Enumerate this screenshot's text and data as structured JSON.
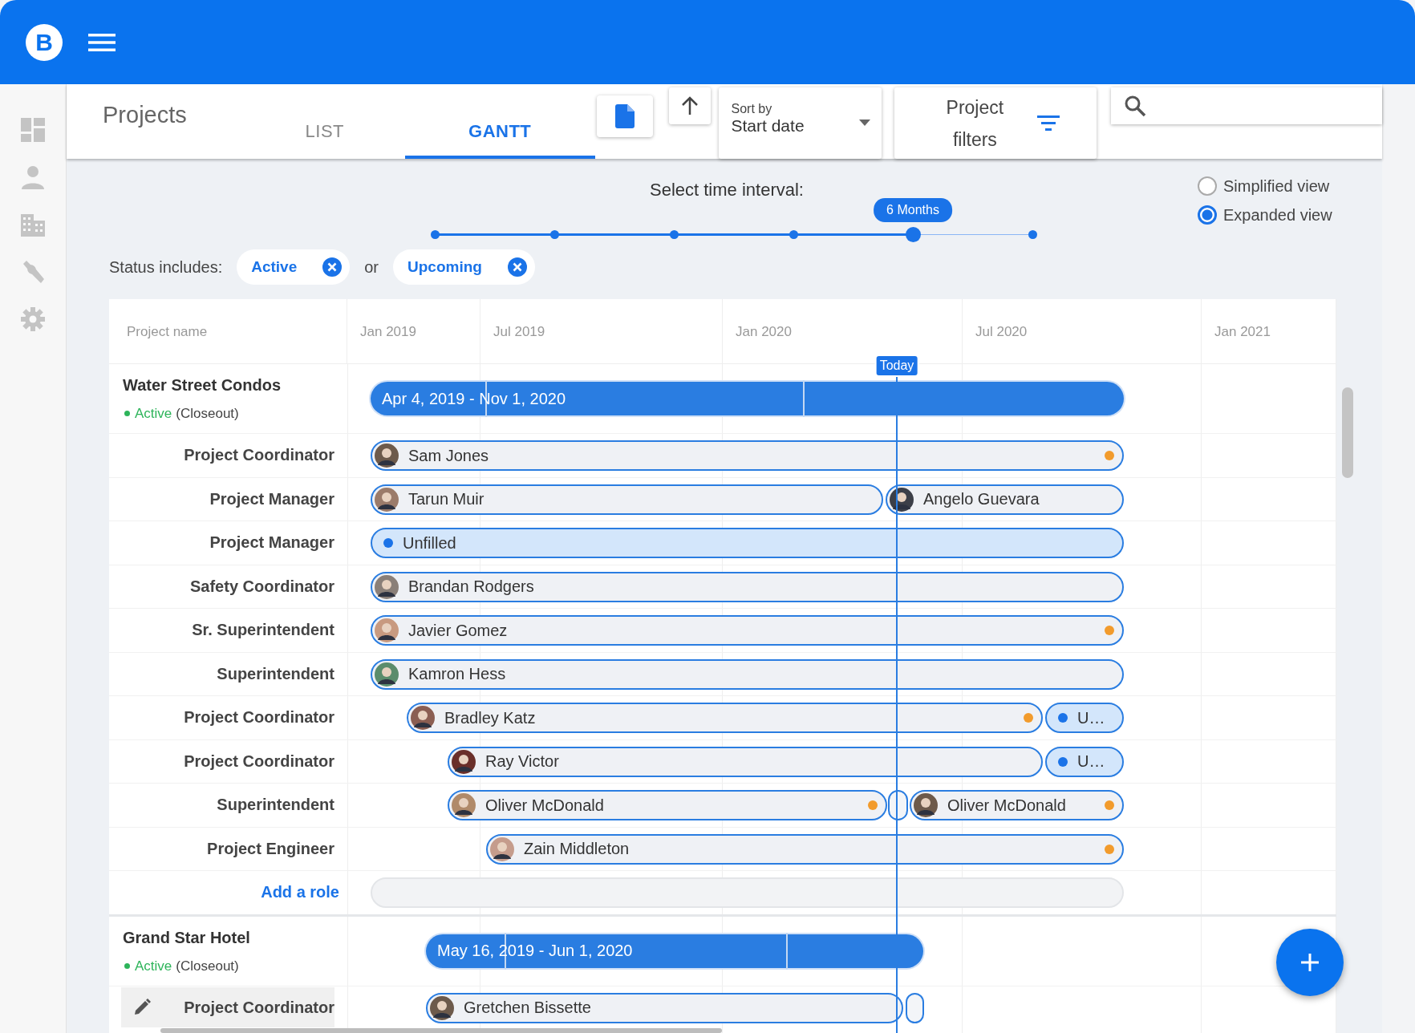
{
  "app_bar": {
    "logo": "B"
  },
  "header": {
    "title": "Projects",
    "tabs": [
      {
        "label": "LIST",
        "selected": false
      },
      {
        "label": "GANTT",
        "selected": true
      }
    ],
    "sort": {
      "label": "Sort by",
      "value": "Start date"
    },
    "filters_button": "Project filters"
  },
  "time_interval": {
    "label": "Select time interval:",
    "value_label": "6 Months",
    "level": 0.8
  },
  "views": [
    {
      "label": "Simplified view",
      "selected": false
    },
    {
      "label": "Expanded view",
      "selected": true
    }
  ],
  "status_filter": {
    "label": "Status includes:",
    "joiner": "or",
    "chips": [
      {
        "label": "Active"
      },
      {
        "label": "Upcoming"
      }
    ]
  },
  "gantt": {
    "name_column": "Project name",
    "months": [
      "Jan 2019",
      "Jul 2019",
      "Jan 2020",
      "Jul 2020",
      "Jan 2021"
    ],
    "today": "Today",
    "projects": [
      {
        "name": "Water Street Condos",
        "status": "Active",
        "phase": "(Closeout)",
        "dates": "Apr 4, 2019 - Nov 1, 2020",
        "add_role": "Add a role",
        "roles": [
          {
            "role": "Project Coordinator",
            "hovered": false,
            "assignments": [
              {
                "kind": "person",
                "name": "Sam Jones",
                "flagged": true
              }
            ]
          },
          {
            "role": "Project Manager",
            "hovered": false,
            "assignments": [
              {
                "kind": "person",
                "name": "Tarun Muir",
                "flagged": false
              },
              {
                "kind": "person",
                "name": "Angelo Guevara",
                "flagged": false
              }
            ]
          },
          {
            "role": "Project Manager",
            "hovered": false,
            "assignments": [
              {
                "kind": "unfilled",
                "name": "Unfilled",
                "flagged": false
              }
            ]
          },
          {
            "role": "Safety Coordinator",
            "hovered": false,
            "assignments": [
              {
                "kind": "person",
                "name": "Brandan Rodgers",
                "flagged": false
              }
            ]
          },
          {
            "role": "Sr. Superintendent",
            "hovered": false,
            "assignments": [
              {
                "kind": "person",
                "name": "Javier Gomez",
                "flagged": true
              }
            ]
          },
          {
            "role": "Superintendent",
            "hovered": false,
            "assignments": [
              {
                "kind": "person",
                "name": "Kamron Hess",
                "flagged": false
              }
            ]
          },
          {
            "role": "Project Coordinator",
            "hovered": false,
            "assignments": [
              {
                "kind": "person",
                "name": "Bradley Katz",
                "flagged": true
              },
              {
                "kind": "unfilled",
                "name": "U…",
                "flagged": false
              }
            ]
          },
          {
            "role": "Project Coordinator",
            "hovered": false,
            "assignments": [
              {
                "kind": "person",
                "name": "Ray Victor",
                "flagged": false
              },
              {
                "kind": "unfilled",
                "name": "U…",
                "flagged": false
              }
            ]
          },
          {
            "role": "Superintendent",
            "hovered": false,
            "assignments": [
              {
                "kind": "person",
                "name": "Oliver McDonald",
                "flagged": true
              },
              {
                "kind": "gap"
              },
              {
                "kind": "person",
                "name": "Oliver McDonald",
                "flagged": true
              }
            ]
          },
          {
            "role": "Project Engineer",
            "hovered": false,
            "assignments": [
              {
                "kind": "person",
                "name": "Zain Middleton",
                "flagged": true
              }
            ]
          }
        ]
      },
      {
        "name": "Grand Star Hotel",
        "status": "Active",
        "phase": "(Closeout)",
        "dates": "May 16, 2019 - Jun 1, 2020",
        "roles": [
          {
            "role": "Project Coordinator",
            "hovered": true,
            "assignments": [
              {
                "kind": "person",
                "name": "Gretchen Bissette",
                "flagged": false
              },
              {
                "kind": "gap"
              }
            ]
          }
        ]
      }
    ]
  }
}
